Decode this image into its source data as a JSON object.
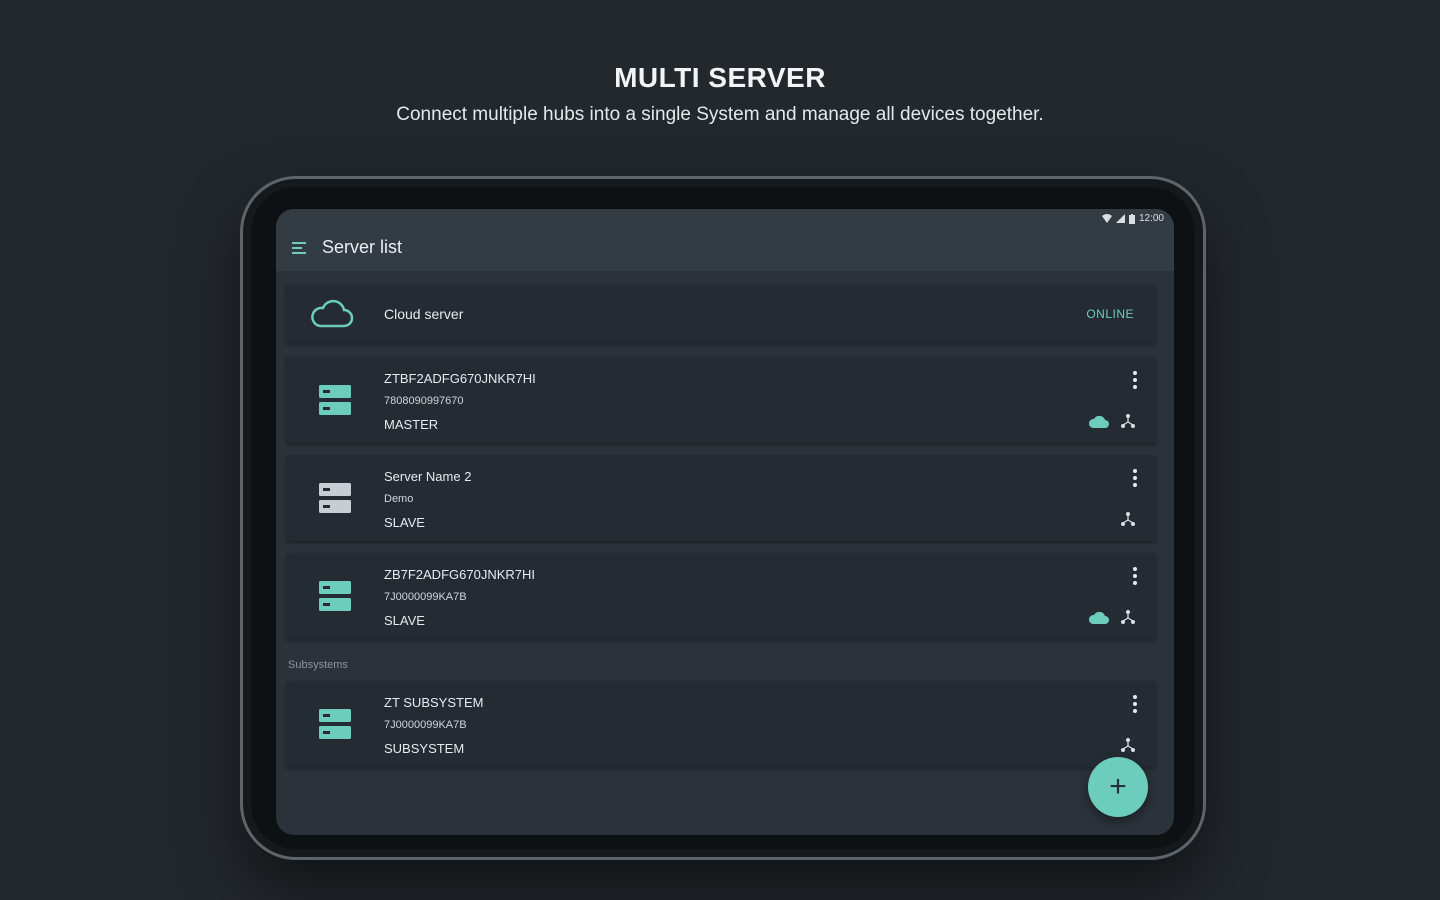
{
  "promo": {
    "title": "MULTI SERVER",
    "subtitle": "Connect multiple hubs into a single System and manage all devices together."
  },
  "status_bar": {
    "time": "12:00"
  },
  "appbar": {
    "title": "Server list",
    "icon": "menu-icon"
  },
  "cloud": {
    "label": "Cloud server",
    "status": "ONLINE",
    "icon": "cloud-icon"
  },
  "servers": [
    {
      "name": "ZTBF2ADFG670JNKR7HI",
      "id": "7808090997670",
      "role": "MASTER",
      "cloud": true
    },
    {
      "name": "Server Name 2",
      "id": "Demo",
      "role": "SLAVE",
      "cloud": false
    },
    {
      "name": "ZB7F2ADFG670JNKR7HI",
      "id": "7J0000099KA7B",
      "role": "SLAVE",
      "cloud": true
    }
  ],
  "subsystems_label": "Subsystems",
  "subsystems": [
    {
      "name": "ZT SUBSYSTEM",
      "id": "7J0000099KA7B",
      "role": "SUBSYSTEM",
      "cloud": false
    }
  ],
  "fab": {
    "label": "+"
  },
  "colors": {
    "accent": "#6dcdbd",
    "background": "#23282d",
    "card": "#242b32"
  }
}
